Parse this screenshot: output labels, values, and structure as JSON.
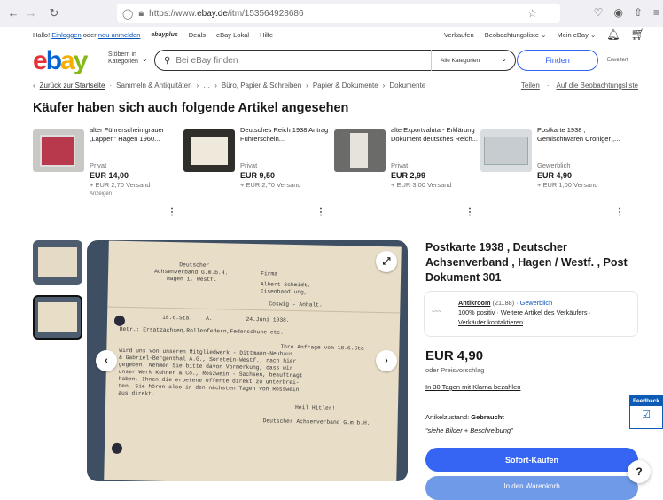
{
  "browser": {
    "url_prefix": "https://www.",
    "url_domain": "ebay.de",
    "url_path": "/itm/153564928686",
    "icons": [
      "back-icon",
      "forward-icon",
      "reload-icon",
      "shield-icon",
      "lock-icon",
      "star-icon",
      "pocket-icon",
      "account-icon",
      "extensions-icon",
      "menu-icon"
    ]
  },
  "topnav": {
    "greeting": "Hallo!",
    "login": "Einloggen",
    "or": "oder",
    "register": "neu anmelden",
    "ebayplus": "ebayplus",
    "deals": "Deals",
    "local": "eBay Lokal",
    "help": "Hilfe",
    "sell": "Verkaufen",
    "watchlist": "Beobachtungsliste",
    "my_ebay": "Mein eBay"
  },
  "header": {
    "logo": [
      "e",
      "b",
      "a",
      "y"
    ],
    "browse_line1": "Stöbern in",
    "browse_line2": "Kategorien",
    "search_placeholder": "Bei eBay finden",
    "category_select": "Alle Kategorien",
    "find_button": "Finden",
    "advanced": "Erweitert"
  },
  "breadcrumb": {
    "back": "Zurück zur Startseite",
    "items": [
      "Sammeln & Antiquitäten",
      "…",
      "Büro, Papier & Schreiben",
      "Papier & Dokumente",
      "Dokumente"
    ],
    "share": "Teilen",
    "watch": "Auf die Beobachtungsliste"
  },
  "section_title": "Käufer haben sich auch folgende Artikel angesehen",
  "cards": [
    {
      "title": "alter Führerschein grauer „Lappen\" Hagen 1960...",
      "condition": "Privat",
      "price": "EUR 14,00",
      "shipping": "+ EUR 2,70 Versand",
      "sub": "Anzeigen"
    },
    {
      "title": "Deutsches Reich 1938 Antrag Führerschein...",
      "condition": "Privat",
      "price": "EUR 9,50",
      "shipping": "+ EUR 2,70 Versand",
      "sub": ""
    },
    {
      "title": "alte Exportvaluta - Erklärung Dokument deutsches Reich...",
      "condition": "Privat",
      "price": "EUR 2,99",
      "shipping": "+ EUR 3,00 Versand",
      "sub": ""
    },
    {
      "title": "Postkarte 1938 , Gemischtwaren Cröniger ,...",
      "condition": "Gewerblich",
      "price": "EUR 4,90",
      "shipping": "+ EUR 1,00 Versand",
      "sub": ""
    }
  ],
  "document": {
    "lines": [
      "Deutscher",
      "Achsenverband G.m.b.H.",
      "Hagen i. Westf.",
      "Firma",
      "Albert Schmidt,",
      "Eisenhandlung,",
      "Coswig - Anhalt.",
      "18.6.Sta.    A.          24.Juni 1938.",
      "Betr.: Ersatzachsen,Rollenfedern,Federschuhe etc.",
      "Ihre Anfrage vom 18.6.Sta",
      "wird uns von unseren Mitgliedwerk - Dittmann-Neuhaus",
      "& Gabriel-Bergenthal A.G., Sorstein-Westf., nach hier",
      "gegeben. Nehmen Sie bitte davon Vormerkung, dass wir",
      "unser Werk Kuhner & Co., Roszwein - Sachsen, beauftragt",
      "haben, Ihnen die erbetene Offerte direkt zu unterbrei-",
      "ten. Sie hören also in den nächsten Tagen von Rosswein",
      "aus direkt.",
      "Heil Hitler!",
      "Deutscher Achsenverband G.m.b.H."
    ]
  },
  "product": {
    "title": "Postkarte 1938 , Deutscher Achsenverband , Hagen / Westf. , Post Dokument 301",
    "seller_name": "Antikroom",
    "seller_count": "(21188)",
    "seller_type": "Gewerblich",
    "positive": "100% positiv",
    "more_items": "Weitere Artikel des Verkäufers",
    "contact": "Verkäufer kontaktieren",
    "price": "EUR 4,90",
    "offer": "oder Preisvorschlag",
    "klarna": "In 30 Tagen mit Klarna bezahlen",
    "condition_label": "Artikelzustand:",
    "condition_value": "Gebraucht",
    "description": "“siehe Bilder + Beschreibung”",
    "buy_now": "Sofort-Kaufen",
    "add_to_cart": "In den Warenkorb"
  },
  "feedback": {
    "label": "Feedback"
  },
  "help": {
    "label": "?"
  }
}
